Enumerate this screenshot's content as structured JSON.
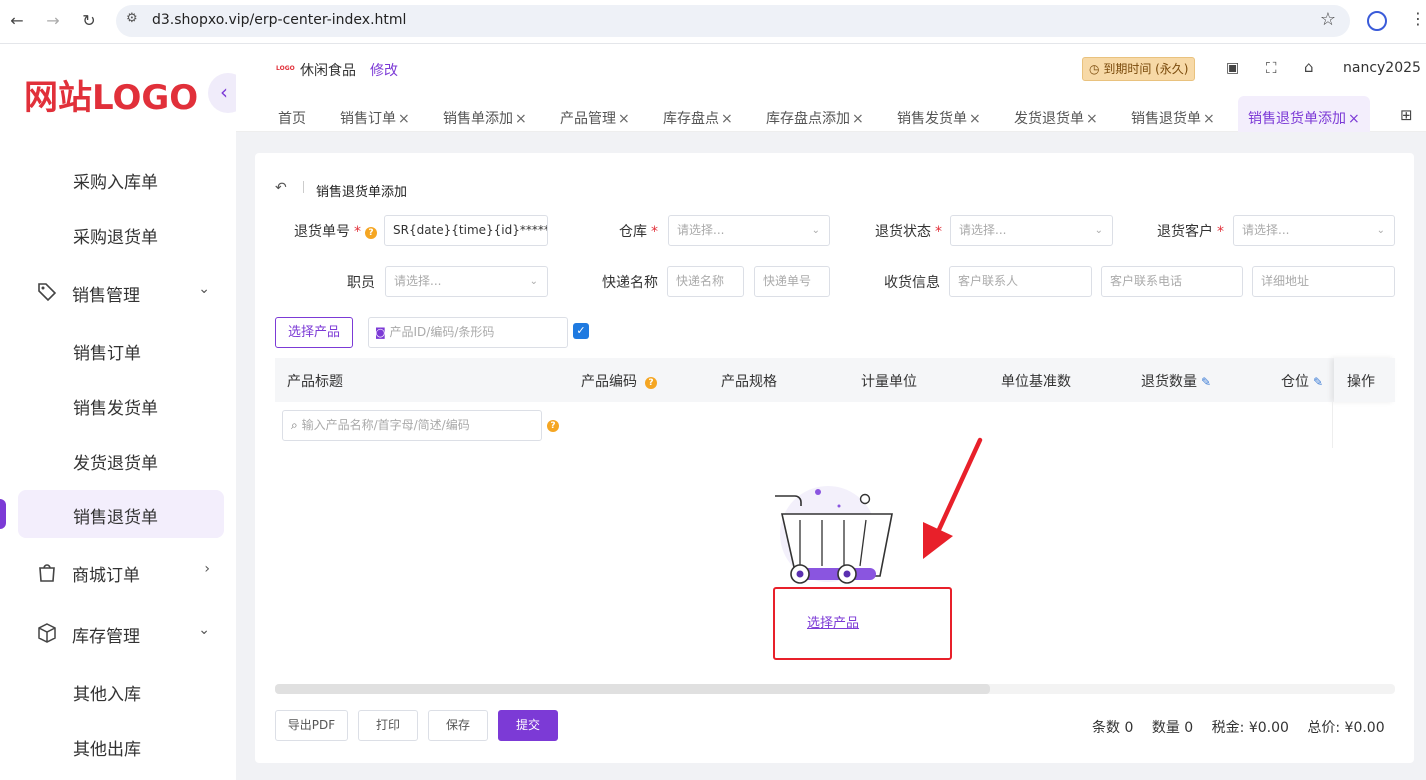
{
  "browser": {
    "url": "d3.shopxo.vip/erp-center-index.html",
    "back_icon": "←",
    "forward_icon": "→",
    "reload_icon": "↻"
  },
  "sidebar": {
    "logo": "网站LOGO",
    "items": [
      {
        "label": "采购入库单"
      },
      {
        "label": "采购退货单"
      },
      {
        "label": "销售管理",
        "group": true
      },
      {
        "label": "销售订单"
      },
      {
        "label": "销售发货单"
      },
      {
        "label": "发货退货单"
      },
      {
        "label": "销售退货单",
        "active": true
      },
      {
        "label": "商城订单",
        "group": true
      },
      {
        "label": "库存管理",
        "group": true
      },
      {
        "label": "其他入库"
      },
      {
        "label": "其他出库"
      }
    ]
  },
  "header": {
    "store_logo": "LOGO",
    "store_name": "休闲食品",
    "edit": "修改",
    "expire": "到期时间 (永久)",
    "username": "nancy2025"
  },
  "tabs": [
    {
      "label": "首页",
      "closable": false
    },
    {
      "label": "销售订单",
      "closable": true
    },
    {
      "label": "销售单添加",
      "closable": true
    },
    {
      "label": "产品管理",
      "closable": true
    },
    {
      "label": "库存盘点",
      "closable": true
    },
    {
      "label": "库存盘点添加",
      "closable": true
    },
    {
      "label": "销售发货单",
      "closable": true
    },
    {
      "label": "发货退货单",
      "closable": true
    },
    {
      "label": "销售退货单",
      "closable": true
    },
    {
      "label": "销售退货单添加",
      "closable": true,
      "active": true
    }
  ],
  "form": {
    "title": "销售退货单添加",
    "return_no_label": "退货单号",
    "return_no_value": "SR{date}{time}{id}******",
    "warehouse_label": "仓库",
    "warehouse_placeholder": "请选择...",
    "status_label": "退货状态",
    "status_placeholder": "请选择...",
    "customer_label": "退货客户",
    "customer_placeholder": "请选择...",
    "staff_label": "职员",
    "staff_placeholder": "请选择...",
    "express_label": "快递名称",
    "express_placeholder": "快递名称",
    "tracking_placeholder": "快递单号",
    "receive_label": "收货信息",
    "contact_placeholder": "客户联系人",
    "phone_placeholder": "客户联系电话",
    "address_placeholder": "详细地址",
    "select_product_btn": "选择产品",
    "product_search_placeholder": "产品ID/编码/条形码",
    "checkbox_checked": true
  },
  "table": {
    "headers": [
      "产品标题",
      "产品编码",
      "产品规格",
      "计量单位",
      "单位基准数",
      "退货数量",
      "仓位",
      "操作"
    ],
    "search_placeholder": "输入产品名称/首字母/简述/编码",
    "empty_link": "选择产品"
  },
  "footer": {
    "buttons": [
      "导出PDF",
      "打印",
      "保存",
      "提交"
    ],
    "count_label": "条数",
    "count_value": "0",
    "qty_label": "数量",
    "qty_value": "0",
    "tax_label": "税金:",
    "tax_value": "¥0.00",
    "total_label": "总价:",
    "total_value": "¥0.00"
  },
  "colors": {
    "accent": "#7c3ad6",
    "annotation": "#e8202a",
    "logo": "#e1303a"
  }
}
